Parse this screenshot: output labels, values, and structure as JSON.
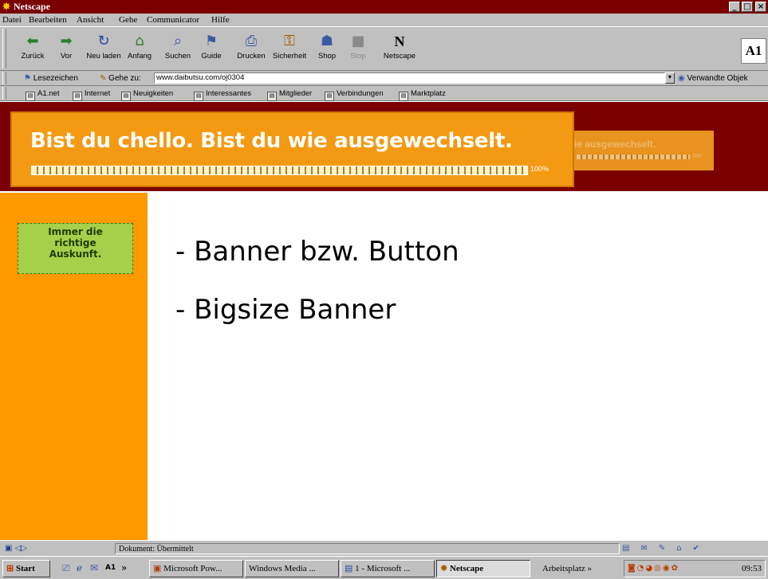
{
  "window": {
    "title": "Netscape",
    "controls": {
      "minimize": "_",
      "maximize": "□",
      "close": "×"
    }
  },
  "menu": [
    "Datei",
    "Bearbeiten",
    "Ansicht",
    "Gehe",
    "Communicator",
    "Hilfe"
  ],
  "toolbar": {
    "buttons": [
      {
        "label": "Zurück",
        "icon": "back-arrow-icon",
        "glyph": "⬅"
      },
      {
        "label": "Vor",
        "icon": "forward-arrow-icon",
        "glyph": "➡"
      },
      {
        "label": "Neu laden",
        "icon": "reload-icon",
        "glyph": "↻"
      },
      {
        "label": "Anfang",
        "icon": "home-icon",
        "glyph": "⌂"
      },
      {
        "label": "Suchen",
        "icon": "search-icon",
        "glyph": "⌕"
      },
      {
        "label": "Guide",
        "icon": "guide-icon",
        "glyph": "⚑"
      },
      {
        "label": "Drucken",
        "icon": "print-icon",
        "glyph": "⎙"
      },
      {
        "label": "Sicherheit",
        "icon": "lock-icon",
        "glyph": "⚿"
      },
      {
        "label": "Shop",
        "icon": "shop-icon",
        "glyph": "☗"
      },
      {
        "label": "Stop",
        "icon": "stop-icon",
        "glyph": "■",
        "disabled": true
      },
      {
        "label": "Netscape",
        "icon": "netscape-icon",
        "glyph": "N"
      }
    ],
    "logo": "A1"
  },
  "location": {
    "bookmarks_label": "Lesezeichen",
    "goto_label": "Gehe zu:",
    "url": "www.daibutsu.com/oj0304",
    "related_label": "Verwandte Objek"
  },
  "personal_toolbar": [
    "A1.net",
    "Internet",
    "Neuigkeiten",
    "Interessantes",
    "Mitglieder",
    "Verbindungen",
    "Marktplatz"
  ],
  "page": {
    "banner": {
      "headline": "Bist du chello. Bist du wie ausgewechselt.",
      "progress_label": "100%",
      "progress": 1.0,
      "echo_headline": "ie ausgewechselt.",
      "echo_label": "ten"
    },
    "side_button_lines": [
      "Immer die",
      "richtige",
      "Auskunft."
    ],
    "bullets": [
      "- Banner bzw. Button",
      "- Bigsize Banner"
    ],
    "colors": {
      "header": "#7a0000",
      "banner": "#f39a12",
      "sidebar": "#ff9900",
      "side_button": "#a5d14a"
    }
  },
  "status": {
    "text": "Dokument: Übermittelt",
    "icons": [
      "security-icon",
      "component-bar-icons"
    ]
  },
  "taskbar": {
    "start_label": "Start",
    "quicklaunch_more": "»",
    "tasks": [
      {
        "label": "Microsoft Pow...",
        "active": false
      },
      {
        "label": "Windows Media ...",
        "active": false
      },
      {
        "label": "1 - Microsoft ...",
        "active": false
      },
      {
        "label": "Netscape",
        "active": true
      }
    ],
    "desktop_label": "Arbeitsplatz »",
    "clock": "09:53"
  }
}
